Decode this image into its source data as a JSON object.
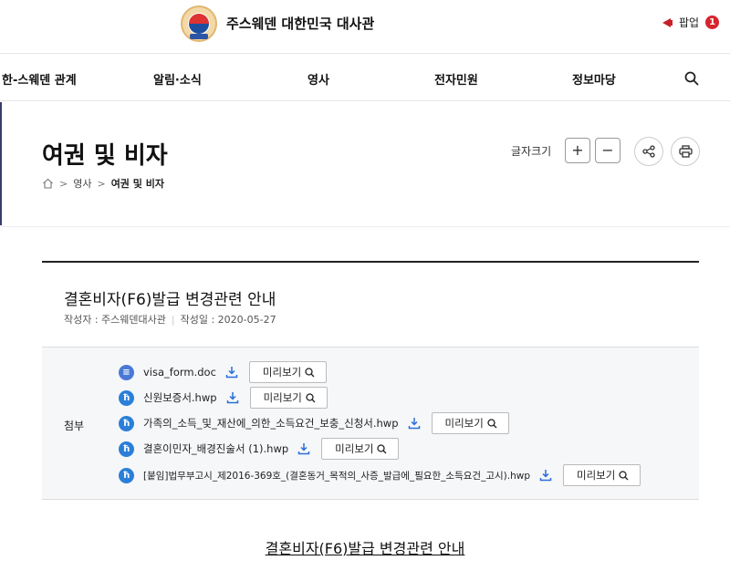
{
  "header": {
    "site_title": "주스웨덴 대한민국 대사관",
    "popup_label": "팝업",
    "popup_count": "1"
  },
  "nav": {
    "items": [
      "한-스웨덴 관계",
      "알림·소식",
      "영사",
      "전자민원",
      "정보마당"
    ]
  },
  "page": {
    "title": "여권 및 비자",
    "font_size_label": "글자크기",
    "plus": "+",
    "minus": "−",
    "breadcrumb": [
      "영사",
      "여권 및 비자"
    ]
  },
  "article": {
    "title": "결혼비자(F6)발급 변경관련 안내",
    "author_label": "작성자 : 주스웨덴대사관",
    "date_label": "작성일 : 2020-05-27",
    "attach_label": "첨부",
    "preview_label": "미리보기",
    "files": [
      {
        "name": "visa_form.doc",
        "type": "doc-icon"
      },
      {
        "name": "신원보증서.hwp",
        "type": "hwp-icon"
      },
      {
        "name": "가족의_소득_및_재산에_의한_소득요건_보충_신청서.hwp",
        "type": "hwp-icon"
      },
      {
        "name": "결혼이민자_배경진술서 (1).hwp",
        "type": "hwp-icon"
      },
      {
        "name": "[붙임]법무부고시_제2016-369호_(결혼동거_목적의_사증_발급에_필요한_소득요건_고시).hwp",
        "type": "hwp-icon"
      }
    ],
    "content_link": "결혼비자(F6)발급 변경관련 안내"
  },
  "colors": {
    "accent_red": "#d6242c",
    "file_icon_blue": "#2b7fd8",
    "download_blue": "#2b6fd6"
  }
}
